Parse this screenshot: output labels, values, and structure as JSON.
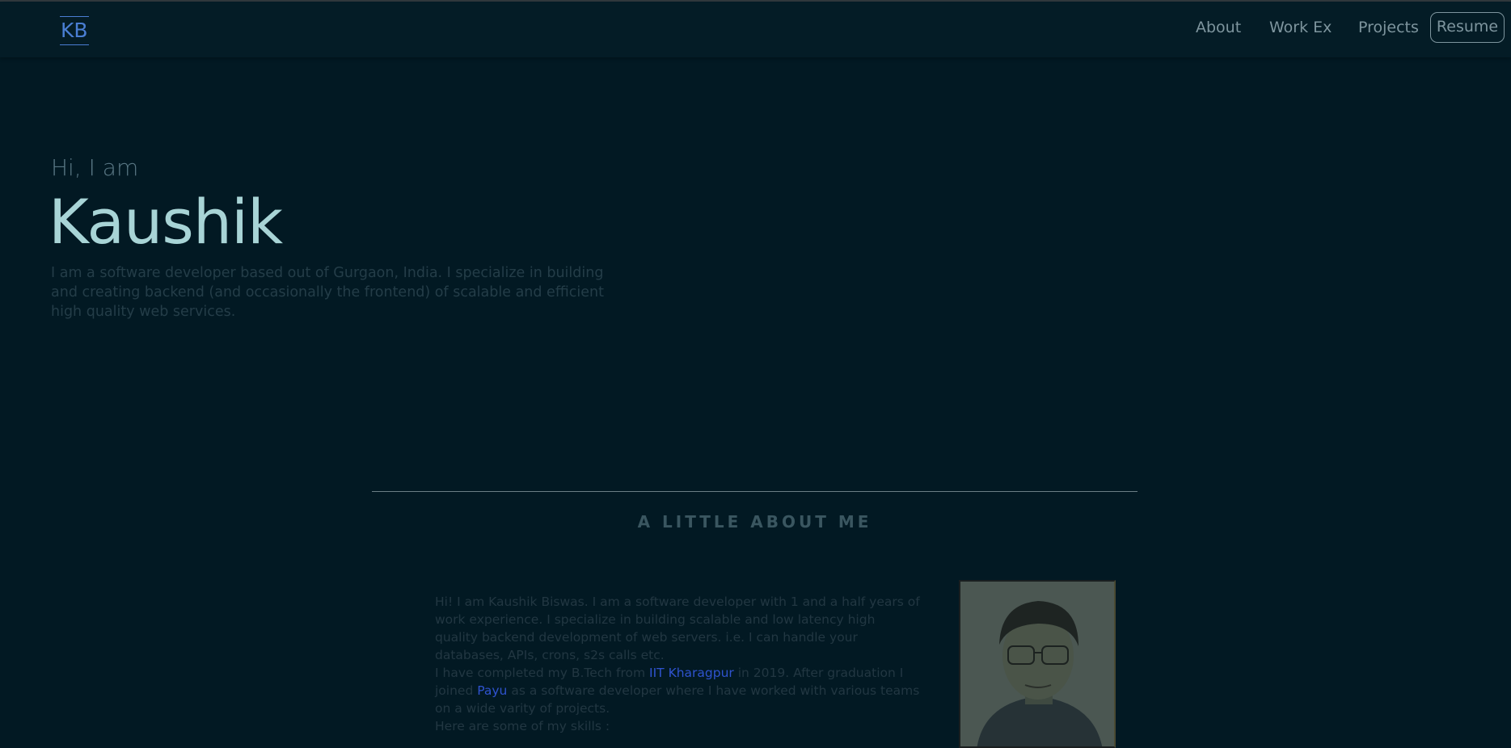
{
  "nav": {
    "logo": "KB",
    "links": [
      "About",
      "Work Ex",
      "Projects"
    ],
    "resume_label": "Resume"
  },
  "hero": {
    "greeting": "Hi, I am",
    "name": "Kaushik",
    "intro": "I am a software developer based out of Gurgaon, India. I specialize in building and creating backend (and occasionally the frontend) of scalable and efficient high quality web services."
  },
  "about": {
    "title": "A LITTLE ABOUT ME",
    "para1": "Hi! I am Kaushik Biswas. I am a software developer with 1 and a half years of work experience. I specialize in building scalable and low latency high quality backend development of web servers. i.e. I can handle your databases, APIs, crons, s2s calls etc.",
    "para2_before": "I have completed my B.Tech from ",
    "para2_link1": "IIT Kharagpur",
    "para2_middle": " in 2019. After graduation I joined ",
    "para2_link2": "Payu",
    "para2_after": " as a software developer where I have worked with various teams on a wide varity of projects.",
    "para3": "Here are some of my skills :"
  },
  "colors": {
    "background": "#021923",
    "accent": "#4a7ed3",
    "link": "#2f53cf",
    "name": "#a8d4d6"
  }
}
